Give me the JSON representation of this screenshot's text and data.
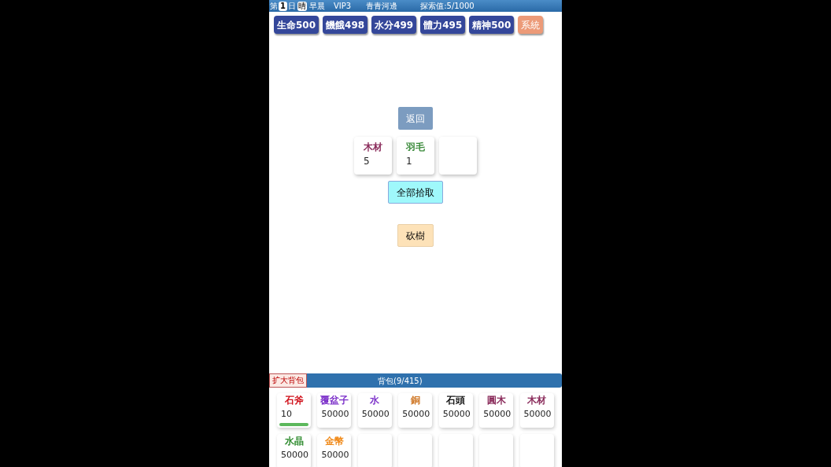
{
  "status_bar": {
    "day_prefix": "第",
    "day": "1",
    "day_suffix": "日",
    "weather": "晴",
    "time": "早晨",
    "vip": "VIP3",
    "location": "青青河邊",
    "explore": "探索值:5/1000"
  },
  "stats": [
    {
      "label": "生命500",
      "kind": "stat"
    },
    {
      "label": "饑餓498",
      "kind": "stat"
    },
    {
      "label": "水分499",
      "kind": "stat"
    },
    {
      "label": "體力495",
      "kind": "stat"
    },
    {
      "label": "精神500",
      "kind": "stat"
    },
    {
      "label": "系統",
      "kind": "system"
    }
  ],
  "back_button": "返回",
  "loot": [
    {
      "name": "木材",
      "count": "5",
      "color": "#8b2d5c"
    },
    {
      "name": "羽毛",
      "count": "1",
      "color": "#3a8a3a"
    }
  ],
  "pick_all_button": "全部拾取",
  "action_button": "砍樹",
  "bag": {
    "expand_button": "扩大背包",
    "title": "背包(9/415)",
    "items": [
      {
        "name": "石斧",
        "count": "10",
        "color": "#d0101a",
        "kind": "tool"
      },
      {
        "name": "覆盆子",
        "count": "50000",
        "color": "#7b2fc9"
      },
      {
        "name": "水",
        "count": "50000",
        "color": "#7b2fc9"
      },
      {
        "name": "銅",
        "count": "50000",
        "color": "#d07a2a"
      },
      {
        "name": "石頭",
        "count": "50000",
        "color": "#111111"
      },
      {
        "name": "圓木",
        "count": "50000",
        "color": "#8b2d5c"
      },
      {
        "name": "木材",
        "count": "50000",
        "color": "#8b2d5c"
      },
      {
        "name": "水晶",
        "count": "50000",
        "color": "#2e8b2e"
      },
      {
        "name": "金幣",
        "count": "50000",
        "color": "#f08a1a"
      }
    ]
  }
}
